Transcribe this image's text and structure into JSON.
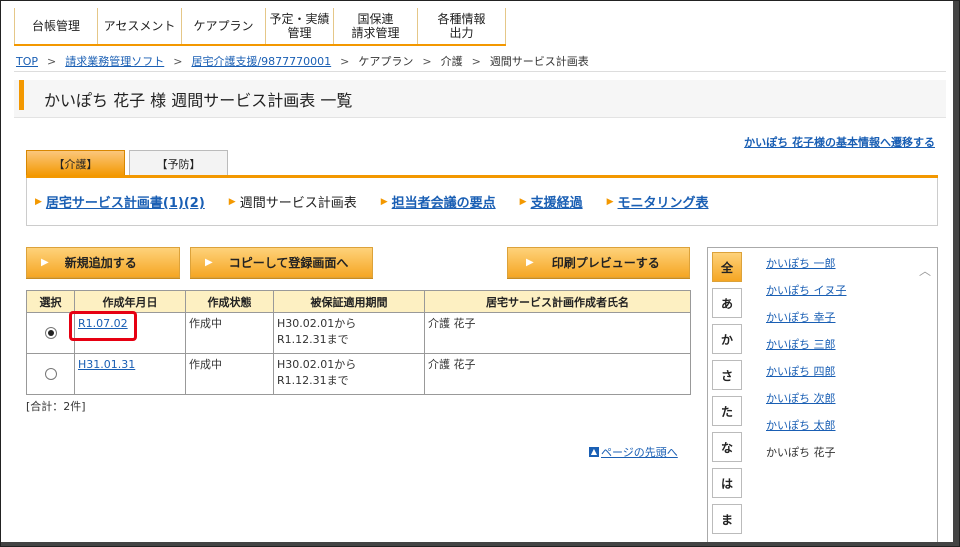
{
  "topnav": [
    "台帳管理",
    "アセスメント",
    "ケアプラン",
    "予定・実績\n管理",
    "国保連\n請求管理",
    "各種情報\n出力"
  ],
  "breadcrumb": {
    "items": [
      {
        "label": "TOP",
        "link": true
      },
      {
        "label": "請求業務管理ソフト",
        "link": true
      },
      {
        "label": "居宅介護支援/9877770001",
        "link": true
      },
      {
        "label": "ケアプラン",
        "link": false
      },
      {
        "label": "介護",
        "link": false
      },
      {
        "label": "週間サービス計画表",
        "link": false
      }
    ],
    "separator": ">"
  },
  "page_title": "かいぽち 花子 様 週間サービス計画表 一覧",
  "basic_info_link": "かいぽち 花子様の基本情報へ遷移する",
  "tabs": {
    "kaigo": "【介護】",
    "yobo": "【予防】"
  },
  "subnav": [
    {
      "label": "居宅サービス計画書(1)(2)",
      "link": true
    },
    {
      "label": "週間サービス計画表",
      "link": false
    },
    {
      "label": "担当者会議の要点",
      "link": true
    },
    {
      "label": "支援経過",
      "link": true
    },
    {
      "label": "モニタリング表",
      "link": true
    }
  ],
  "buttons": {
    "new": "新規追加する",
    "copy": "コピーして登録画面へ",
    "print": "印刷プレビューする"
  },
  "table": {
    "headers": [
      "選択",
      "作成年月日",
      "作成状態",
      "被保証適用期間",
      "居宅サービス計画作成者氏名"
    ],
    "rows": [
      {
        "selected": true,
        "date": "R1.07.02",
        "status": "作成中",
        "period_from": "H30.02.01から",
        "period_to": "R1.12.31まで",
        "author": "介護 花子"
      },
      {
        "selected": false,
        "date": "H31.01.31",
        "status": "作成中",
        "period_from": "H30.02.01から",
        "period_to": "R1.12.31まで",
        "author": "介護 花子"
      }
    ]
  },
  "total": "[合計：2件]",
  "page_top": "ページの先頭へ",
  "kana_index": [
    "全",
    "あ",
    "か",
    "さ",
    "た",
    "な",
    "は",
    "ま"
  ],
  "client_names": [
    {
      "name": "かいぽち 一郎",
      "link": true
    },
    {
      "name": "かいぽち イヌ子",
      "link": true
    },
    {
      "name": "かいぽち 幸子",
      "link": true
    },
    {
      "name": "かいぽち 三郎",
      "link": true
    },
    {
      "name": "かいぽち 四郎",
      "link": true
    },
    {
      "name": "かいぽち 次郎",
      "link": true
    },
    {
      "name": "かいぽち 太郎",
      "link": true
    },
    {
      "name": "かいぽち 花子",
      "link": false
    }
  ],
  "colors": {
    "accent": "#f39800",
    "link": "#1a5fb4",
    "highlight_box": "#e60012",
    "table_header": "#fdf0c2"
  }
}
